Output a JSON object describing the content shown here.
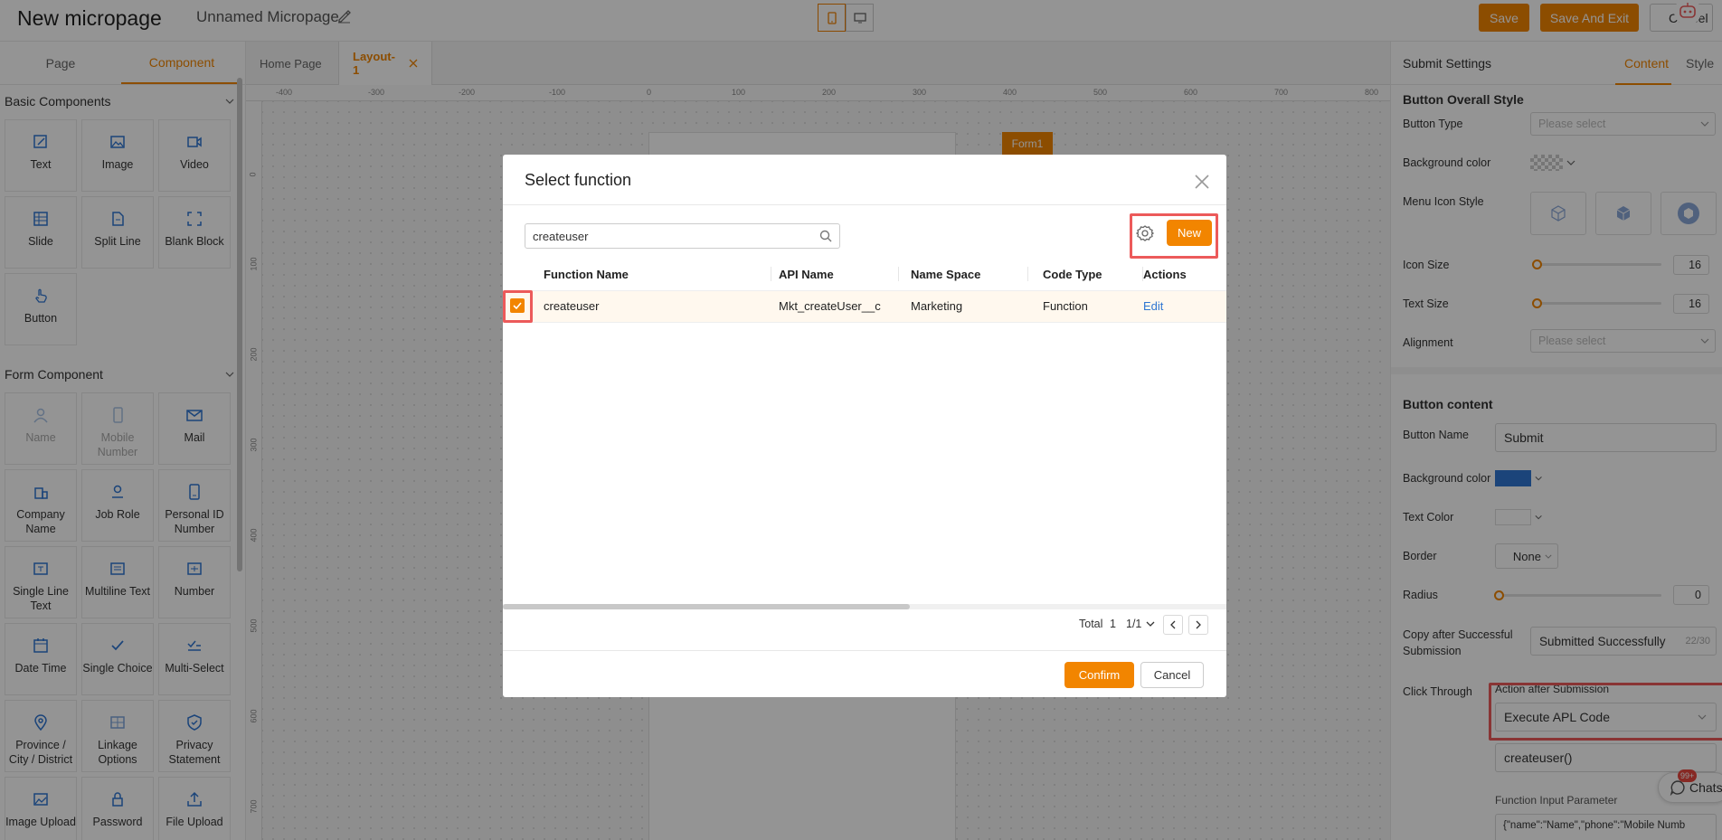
{
  "header": {
    "app_title": "New micropage",
    "page_name": "Unnamed Micropage",
    "save": "Save",
    "save_exit": "Save And Exit",
    "cancel": "Cancel"
  },
  "left_panel": {
    "tabs": [
      "Page",
      "Component"
    ],
    "active_tab": "Component",
    "sections": [
      {
        "title": "Basic Components",
        "items": [
          {
            "label": "Text",
            "icon": "text-edit-icon"
          },
          {
            "label": "Image",
            "icon": "image-icon"
          },
          {
            "label": "Video",
            "icon": "video-icon"
          },
          {
            "label": "Slide",
            "icon": "slide-icon"
          },
          {
            "label": "Split Line",
            "icon": "split-line-icon"
          },
          {
            "label": "Blank Block",
            "icon": "blank-block-icon"
          },
          {
            "label": "Button",
            "icon": "button-pointer-icon"
          }
        ]
      },
      {
        "title": "Form Component",
        "items": [
          {
            "label": "Name",
            "icon": "person-icon",
            "disabled": true
          },
          {
            "label": "Mobile Number",
            "icon": "mobile-icon",
            "disabled": true
          },
          {
            "label": "Mail",
            "icon": "mail-icon"
          },
          {
            "label": "Company Name",
            "icon": "building-icon"
          },
          {
            "label": "Job Role",
            "icon": "job-role-icon"
          },
          {
            "label": "Personal ID Number",
            "icon": "id-card-icon"
          },
          {
            "label": "Single Line Text",
            "icon": "single-line-text-icon"
          },
          {
            "label": "Multiline Text",
            "icon": "multiline-text-icon"
          },
          {
            "label": "Number",
            "icon": "number-icon"
          },
          {
            "label": "Date Time",
            "icon": "calendar-icon"
          },
          {
            "label": "Single Choice",
            "icon": "check-icon"
          },
          {
            "label": "Multi-Select",
            "icon": "multi-check-icon"
          },
          {
            "label": "Province / City / District",
            "icon": "location-pin-icon"
          },
          {
            "label": "Linkage Options",
            "icon": "linkage-icon"
          },
          {
            "label": "Privacy Statement",
            "icon": "shield-icon"
          },
          {
            "label": "Image Upload",
            "icon": "image-upload-icon"
          },
          {
            "label": "Password",
            "icon": "lock-icon"
          },
          {
            "label": "File Upload",
            "icon": "upload-icon"
          }
        ]
      }
    ]
  },
  "canvas": {
    "tabs": [
      "Home Page",
      "Layout-1"
    ],
    "active_tab": "Layout-1",
    "ruler_h": [
      "-400",
      "-300",
      "-200",
      "-100",
      "0",
      "100",
      "200",
      "300",
      "400",
      "500",
      "600",
      "700",
      "800"
    ],
    "ruler_v": [
      "0",
      "100",
      "200",
      "300",
      "400",
      "500",
      "600",
      "700"
    ],
    "form_tag": "Form1"
  },
  "right_panel": {
    "title": "Submit Settings",
    "tabs": [
      "Content",
      "Style"
    ],
    "active_tab": "Content",
    "overall_section": "Button Overall Style",
    "button_type_label": "Button Type",
    "button_type_placeholder": "Please select",
    "bg_color_label": "Background color",
    "menu_icon_label": "Menu Icon Style",
    "icon_size_label": "Icon Size",
    "icon_size_value": "16",
    "text_size_label": "Text Size",
    "text_size_value": "16",
    "alignment_label": "Alignment",
    "alignment_placeholder": "Please select",
    "content_section": "Button content",
    "button_name_label": "Button Name",
    "button_name_value": "Submit",
    "bg_color2_label": "Background color",
    "bg_color2_value": "#2f76d2",
    "text_color_label": "Text Color",
    "border_label": "Border",
    "border_value": "None",
    "radius_label": "Radius",
    "radius_value": "0",
    "copy_label": "Copy after Successful Submission",
    "copy_value": "Submitted Successfully",
    "copy_count": "22/30",
    "click_through_label": "Click Through",
    "action_label": "Action after Submission",
    "action_value": "Execute APL Code",
    "function_value": "createuser()",
    "input_param_label": "Function Input Parameter",
    "input_param_value": "{\"name\":\"Name\",\"phone\":\"Mobile Numb"
  },
  "chat": {
    "label": "Chats",
    "badge": "99+"
  },
  "modal": {
    "title": "Select function",
    "search_value": "createuser",
    "new_label": "New",
    "columns": [
      "Function Name",
      "API Name",
      "Name Space",
      "Code Type",
      "Actions"
    ],
    "rows": [
      {
        "function_name": "createuser",
        "api_name": "Mkt_createUser__c",
        "name_space": "Marketing",
        "code_type": "Function",
        "action": "Edit",
        "checked": true
      }
    ],
    "total_label": "Total",
    "total_value": "1",
    "page_value": "1/1",
    "confirm": "Confirm",
    "cancel": "Cancel"
  },
  "colors": {
    "accent": "#f28500",
    "highlight_frame": "#ec5a5a",
    "link": "#2f76d2"
  }
}
